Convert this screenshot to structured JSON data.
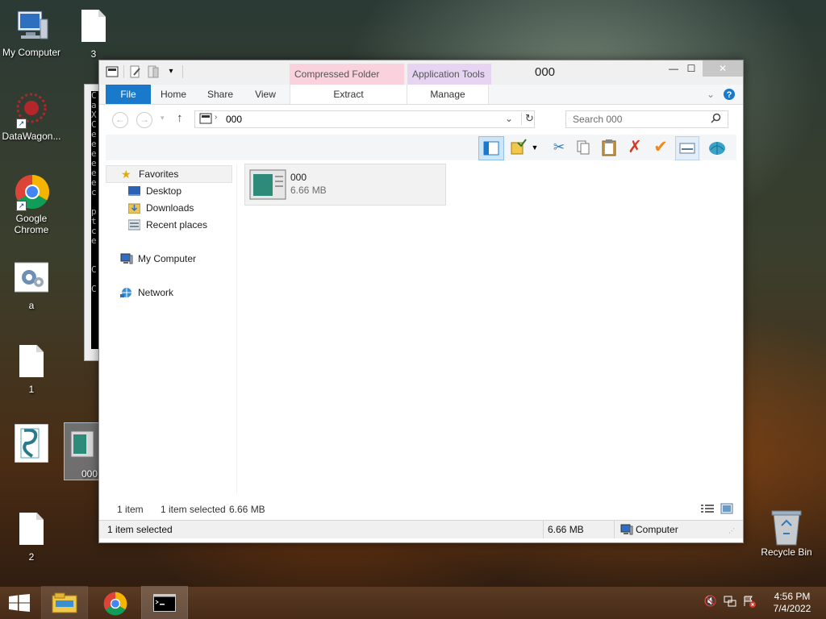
{
  "desktop": {
    "icons": [
      {
        "label": "My Computer"
      },
      {
        "label": "3"
      },
      {
        "label": "DataWagon..."
      },
      {
        "label": "Google Chrome"
      },
      {
        "label": "a"
      },
      {
        "label": "1"
      },
      {
        "label": ""
      },
      {
        "label": "000"
      },
      {
        "label": "2"
      },
      {
        "label": "Recycle Bin"
      }
    ]
  },
  "console": {
    "lines": "C\na\nX\nC\ne\ne\ne\ne\ne\ne\nc\n\np\nt\nc\ne\n\n\nC\n\nC"
  },
  "window": {
    "title": "000",
    "context_tabs": {
      "compressed": "Compressed Folder Tools",
      "application": "Application Tools"
    },
    "ribbon_tabs": {
      "file": "File",
      "home": "Home",
      "share": "Share",
      "view": "View",
      "extract": "Extract",
      "manage": "Manage"
    },
    "address": {
      "path": "000"
    },
    "search": {
      "placeholder": "Search 000"
    },
    "nav": {
      "favorites": "Favorites",
      "desktop": "Desktop",
      "downloads": "Downloads",
      "recent": "Recent places",
      "my_computer": "My Computer",
      "network": "Network"
    },
    "content": {
      "files": [
        {
          "name": "000",
          "size": "6.66 MB"
        }
      ]
    },
    "status": {
      "items": "1 item",
      "selected": "1 item selected",
      "selected_size": "6.66 MB",
      "bottom_selected": "1 item selected",
      "bottom_size": "6.66 MB",
      "location": "Computer"
    }
  },
  "taskbar": {
    "clock_time": "4:56 PM",
    "clock_date": "7/4/2022"
  },
  "colors": {
    "accent": "#1979ca",
    "compressed_tab": "#f9d2de",
    "application_tab": "#e6d4f2"
  }
}
